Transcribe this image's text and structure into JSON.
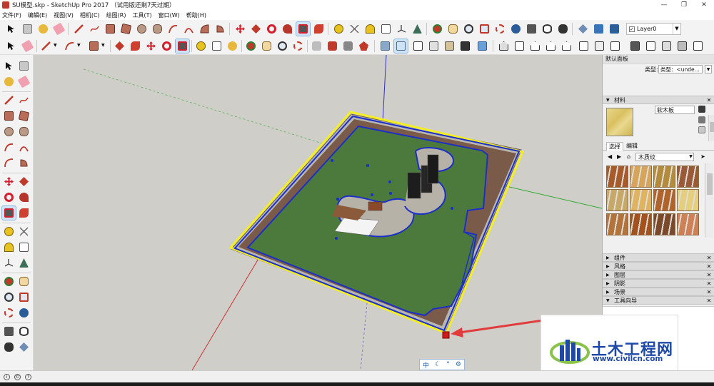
{
  "window": {
    "title": "SU模型.skp - SketchUp Pro 2017 （试用版还剩7天过期）",
    "controls": [
      "—",
      "❐",
      "✕"
    ]
  },
  "menu": [
    "文件(F)",
    "编辑(E)",
    "视图(V)",
    "相机(C)",
    "绘图(R)",
    "工具(T)",
    "窗口(W)",
    "帮助(H)"
  ],
  "toolbar": {
    "layer_value": "Layer0",
    "layer_check": "✓"
  },
  "tray": {
    "title": "默认面板",
    "type_label": "类型:",
    "type_value": "类型：<unde...",
    "materials_header": "材料",
    "material_name": "软木板",
    "tab_select": "选择",
    "tab_edit": "编辑",
    "collection": "木质纹",
    "panels": [
      "组件",
      "风格",
      "图层",
      "阴影",
      "场景",
      "工具向导"
    ],
    "swatch_colors": [
      "#a85b2a",
      "#d7a55a",
      "#b48a3b",
      "#9b5a37",
      "#c7a866",
      "#e0b45f",
      "#b0642b",
      "#e5cf7d",
      "#b2743b",
      "#a3521e",
      "#7a4a2a",
      "#cf8155"
    ],
    "material_color": "#dcc46a"
  },
  "style_bar": {
    "label": "中"
  },
  "watermark": {
    "cn": "土木工程网",
    "url": "www.civilcn.com",
    "color": "#1f49a8"
  },
  "colors": {
    "viewport_bg": "#cfcec9",
    "lawn": "#4c7a3c",
    "selection_yellow": "#f3ef24",
    "selection_blue": "#1c2fc8",
    "axis_red": "#cc3333",
    "axis_green": "#33aa33",
    "axis_blue": "#3333bb"
  }
}
